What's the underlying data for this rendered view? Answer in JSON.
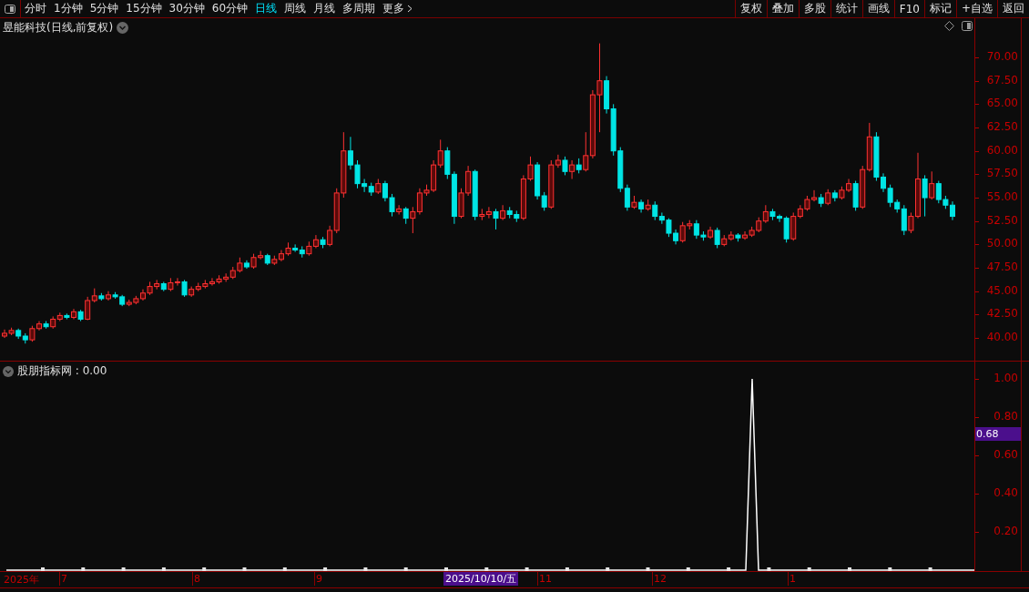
{
  "toolbar": {
    "periods": [
      {
        "label": "分时",
        "selected": false
      },
      {
        "label": "1分钟",
        "selected": false
      },
      {
        "label": "5分钟",
        "selected": false
      },
      {
        "label": "15分钟",
        "selected": false
      },
      {
        "label": "30分钟",
        "selected": false
      },
      {
        "label": "60分钟",
        "selected": false
      },
      {
        "label": "日线",
        "selected": true
      },
      {
        "label": "周线",
        "selected": false
      },
      {
        "label": "月线",
        "selected": false
      },
      {
        "label": "多周期",
        "selected": false
      },
      {
        "label": "更多",
        "selected": false
      }
    ],
    "buttons": [
      "复权",
      "叠加",
      "多股",
      "统计",
      "画线",
      "F10",
      "标记",
      "+自选",
      "返回"
    ]
  },
  "main_chart": {
    "title": "昱能科技(日线,前复权)",
    "chart_data": {
      "type": "candlestick",
      "ylim": [
        37.57,
        74.19
      ],
      "yticks": [
        {
          "value": 70,
          "label": "70.00"
        },
        {
          "value": 67.5,
          "label": "67.50"
        },
        {
          "value": 65,
          "label": "65.00"
        },
        {
          "value": 62.5,
          "label": "62.50"
        },
        {
          "value": 60,
          "label": "60.00"
        },
        {
          "value": 57.5,
          "label": "57.50"
        },
        {
          "value": 55,
          "label": "55.00"
        },
        {
          "value": 52.5,
          "label": "52.50"
        },
        {
          "value": 50,
          "label": "50.00"
        },
        {
          "value": 47.5,
          "label": "47.50"
        },
        {
          "value": 45,
          "label": "45.00"
        },
        {
          "value": 42.5,
          "label": "42.50"
        },
        {
          "value": 40,
          "label": "40.00"
        }
      ],
      "categories": [
        null,
        null,
        null,
        null,
        null,
        null,
        null,
        null,
        null,
        null,
        null,
        null,
        null,
        null,
        null,
        null,
        null,
        null,
        null,
        null,
        null,
        null,
        null,
        null,
        null,
        null,
        null,
        null,
        null,
        null,
        null,
        null,
        null,
        null,
        null,
        null,
        null,
        null,
        null,
        null,
        null,
        null,
        null,
        null,
        null,
        null,
        null,
        null,
        null,
        null,
        null,
        null,
        null,
        null,
        null,
        null,
        null,
        null,
        null,
        null,
        null,
        null,
        null,
        null,
        null,
        null,
        null,
        null,
        null,
        null,
        null,
        null,
        null,
        null,
        null,
        null,
        null,
        null,
        null,
        null,
        null,
        null,
        null,
        null,
        null,
        null,
        null,
        null,
        null,
        null,
        null,
        null,
        null,
        null,
        null,
        null,
        null,
        null,
        null,
        null,
        null,
        null,
        null,
        null,
        null,
        null,
        null,
        null,
        null,
        null,
        null,
        null,
        null,
        null,
        null,
        null,
        null,
        null,
        null,
        null,
        null,
        null,
        null,
        null,
        null,
        null,
        null,
        null,
        null,
        null,
        null,
        null,
        null,
        null,
        null,
        null,
        null,
        null
      ],
      "ohlc": [
        [
          40.2,
          40.9,
          40.0,
          40.5
        ],
        [
          40.5,
          41.1,
          40.3,
          40.8
        ],
        [
          40.8,
          41.0,
          39.9,
          40.2
        ],
        [
          40.2,
          40.5,
          39.4,
          39.8
        ],
        [
          39.8,
          41.3,
          39.6,
          41.0
        ],
        [
          41.0,
          41.8,
          40.8,
          41.5
        ],
        [
          41.5,
          41.8,
          41.0,
          41.2
        ],
        [
          41.2,
          42.3,
          41.0,
          42.0
        ],
        [
          42.0,
          42.7,
          41.8,
          42.4
        ],
        [
          42.4,
          42.6,
          42.0,
          42.2
        ],
        [
          42.2,
          43.1,
          42.0,
          42.8
        ],
        [
          42.8,
          43.0,
          41.8,
          42.0
        ],
        [
          42.0,
          44.4,
          41.9,
          44.0
        ],
        [
          44.0,
          45.3,
          43.8,
          44.5
        ],
        [
          44.5,
          44.8,
          44.0,
          44.2
        ],
        [
          44.2,
          45.0,
          44.0,
          44.6
        ],
        [
          44.6,
          44.9,
          44.2,
          44.4
        ],
        [
          44.4,
          44.6,
          43.4,
          43.6
        ],
        [
          43.6,
          44.1,
          43.4,
          43.8
        ],
        [
          43.8,
          44.5,
          43.6,
          44.2
        ],
        [
          44.2,
          45.2,
          44.0,
          44.8
        ],
        [
          44.8,
          46.0,
          44.6,
          45.5
        ],
        [
          45.5,
          46.2,
          45.2,
          45.8
        ],
        [
          45.8,
          46.0,
          45.0,
          45.2
        ],
        [
          45.2,
          46.4,
          45.0,
          45.9
        ],
        [
          45.9,
          46.4,
          45.6,
          46.0
        ],
        [
          46.0,
          46.2,
          44.4,
          44.6
        ],
        [
          44.6,
          45.5,
          44.4,
          45.2
        ],
        [
          45.2,
          45.9,
          45.0,
          45.5
        ],
        [
          45.5,
          46.2,
          45.3,
          45.8
        ],
        [
          45.8,
          46.4,
          45.6,
          46.0
        ],
        [
          46.0,
          46.7,
          45.8,
          46.3
        ],
        [
          46.3,
          46.9,
          46.0,
          46.5
        ],
        [
          46.5,
          47.6,
          46.3,
          47.2
        ],
        [
          47.2,
          48.6,
          47.0,
          48.0
        ],
        [
          48.0,
          48.3,
          47.4,
          47.6
        ],
        [
          47.6,
          49.0,
          47.4,
          48.6
        ],
        [
          48.6,
          49.3,
          48.4,
          48.8
        ],
        [
          48.8,
          49.0,
          47.8,
          48.0
        ],
        [
          48.0,
          48.8,
          47.8,
          48.4
        ],
        [
          48.4,
          49.4,
          48.2,
          49.0
        ],
        [
          49.0,
          50.2,
          48.8,
          49.6
        ],
        [
          49.6,
          50.0,
          49.2,
          49.4
        ],
        [
          49.4,
          49.8,
          48.6,
          49.0
        ],
        [
          49.0,
          50.3,
          48.8,
          49.8
        ],
        [
          49.8,
          51.0,
          49.6,
          50.5
        ],
        [
          50.5,
          50.8,
          49.6,
          50.0
        ],
        [
          50.0,
          52.0,
          49.8,
          51.5
        ],
        [
          51.5,
          56.0,
          51.2,
          55.5
        ],
        [
          55.5,
          62.0,
          55.0,
          60.0
        ],
        [
          60.0,
          61.5,
          58.0,
          58.5
        ],
        [
          58.5,
          59.0,
          56.0,
          56.5
        ],
        [
          56.5,
          57.0,
          55.6,
          56.2
        ],
        [
          56.2,
          56.6,
          55.2,
          55.6
        ],
        [
          55.6,
          57.0,
          55.4,
          56.5
        ],
        [
          56.5,
          56.8,
          54.6,
          55.0
        ],
        [
          55.0,
          55.4,
          53.0,
          53.5
        ],
        [
          53.5,
          54.2,
          53.2,
          53.8
        ],
        [
          53.8,
          54.0,
          52.2,
          52.8
        ],
        [
          52.8,
          54.0,
          51.2,
          53.5
        ],
        [
          53.5,
          56.0,
          53.2,
          55.5
        ],
        [
          55.5,
          56.4,
          55.2,
          55.8
        ],
        [
          55.8,
          59.0,
          55.6,
          58.5
        ],
        [
          58.5,
          61.2,
          58.2,
          60.0
        ],
        [
          60.0,
          60.4,
          57.0,
          57.5
        ],
        [
          57.5,
          57.8,
          52.2,
          53.0
        ],
        [
          53.0,
          56.0,
          52.8,
          55.5
        ],
        [
          55.5,
          58.4,
          55.2,
          57.8
        ],
        [
          57.8,
          58.0,
          52.6,
          53.0
        ],
        [
          53.0,
          53.8,
          52.6,
          53.2
        ],
        [
          53.2,
          54.0,
          52.8,
          53.5
        ],
        [
          53.5,
          53.8,
          51.6,
          52.8
        ],
        [
          52.8,
          54.2,
          52.6,
          53.6
        ],
        [
          53.6,
          54.0,
          52.8,
          53.2
        ],
        [
          53.2,
          53.6,
          52.4,
          52.8
        ],
        [
          52.8,
          57.4,
          52.6,
          57.0
        ],
        [
          57.0,
          59.4,
          56.8,
          58.5
        ],
        [
          58.5,
          58.8,
          54.8,
          55.2
        ],
        [
          55.2,
          55.6,
          53.6,
          54.0
        ],
        [
          54.0,
          59.0,
          53.8,
          58.5
        ],
        [
          58.5,
          59.6,
          58.2,
          59.0
        ],
        [
          59.0,
          59.4,
          57.4,
          57.8
        ],
        [
          57.8,
          59.0,
          57.0,
          58.5
        ],
        [
          58.5,
          59.2,
          57.6,
          58.0
        ],
        [
          58.0,
          62.0,
          57.8,
          59.5
        ],
        [
          59.5,
          66.5,
          59.2,
          66.0
        ],
        [
          66.0,
          71.5,
          62.0,
          67.5
        ],
        [
          67.5,
          68.0,
          64.0,
          64.5
        ],
        [
          64.5,
          65.0,
          59.5,
          60.0
        ],
        [
          60.0,
          60.4,
          55.6,
          56.0
        ],
        [
          56.0,
          56.4,
          53.6,
          54.0
        ],
        [
          54.0,
          55.2,
          53.8,
          54.5
        ],
        [
          54.5,
          54.8,
          53.4,
          53.8
        ],
        [
          53.8,
          54.8,
          53.6,
          54.2
        ],
        [
          54.2,
          54.6,
          52.6,
          53.0
        ],
        [
          53.0,
          53.4,
          52.2,
          52.6
        ],
        [
          52.6,
          52.8,
          50.8,
          51.2
        ],
        [
          51.2,
          51.6,
          50.0,
          50.4
        ],
        [
          50.4,
          52.4,
          50.2,
          52.0
        ],
        [
          52.0,
          52.6,
          51.6,
          52.2
        ],
        [
          52.2,
          52.6,
          50.6,
          51.0
        ],
        [
          51.0,
          51.4,
          50.4,
          50.8
        ],
        [
          50.8,
          51.9,
          50.6,
          51.5
        ],
        [
          51.5,
          51.8,
          49.6,
          50.0
        ],
        [
          50.0,
          51.0,
          49.8,
          50.6
        ],
        [
          50.6,
          51.4,
          50.4,
          51.0
        ],
        [
          51.0,
          51.2,
          50.3,
          50.7
        ],
        [
          50.7,
          51.4,
          50.5,
          51.0
        ],
        [
          51.0,
          51.9,
          50.8,
          51.5
        ],
        [
          51.5,
          52.9,
          51.3,
          52.5
        ],
        [
          52.5,
          54.2,
          52.3,
          53.5
        ],
        [
          53.5,
          53.8,
          52.6,
          53.0
        ],
        [
          53.0,
          53.2,
          52.4,
          52.8
        ],
        [
          52.8,
          53.0,
          50.2,
          50.6
        ],
        [
          50.6,
          53.4,
          50.4,
          53.0
        ],
        [
          53.0,
          54.2,
          52.8,
          53.8
        ],
        [
          53.8,
          55.2,
          53.6,
          54.8
        ],
        [
          54.8,
          55.8,
          54.6,
          55.0
        ],
        [
          55.0,
          55.4,
          54.0,
          54.4
        ],
        [
          54.4,
          55.9,
          54.2,
          55.5
        ],
        [
          55.5,
          55.8,
          54.6,
          55.0
        ],
        [
          55.0,
          56.2,
          54.8,
          55.8
        ],
        [
          55.8,
          57.0,
          55.6,
          56.5
        ],
        [
          56.5,
          56.8,
          53.6,
          54.0
        ],
        [
          54.0,
          58.4,
          53.8,
          58.0
        ],
        [
          58.0,
          63.0,
          57.8,
          61.5
        ],
        [
          61.5,
          62.0,
          56.8,
          57.2
        ],
        [
          57.2,
          57.6,
          55.6,
          56.0
        ],
        [
          56.0,
          56.4,
          54.0,
          54.5
        ],
        [
          54.5,
          54.8,
          53.4,
          53.8
        ],
        [
          53.8,
          54.2,
          51.0,
          51.5
        ],
        [
          51.5,
          53.4,
          51.2,
          53.0
        ],
        [
          53.0,
          59.8,
          52.8,
          57.0
        ],
        [
          57.0,
          57.4,
          53.0,
          55.0
        ],
        [
          55.0,
          57.8,
          54.8,
          56.5
        ],
        [
          56.5,
          56.8,
          54.4,
          54.8
        ],
        [
          54.8,
          55.2,
          53.8,
          54.2
        ],
        [
          54.2,
          54.6,
          52.6,
          53.0
        ]
      ]
    }
  },
  "indicator": {
    "reading": ": 0.00",
    "cursor_value": "0.68",
    "chart_data": {
      "type": "line",
      "categories": [
        null,
        null,
        null,
        null,
        null,
        null,
        null,
        null,
        null,
        null,
        null,
        null,
        null,
        null,
        null,
        null,
        null,
        null,
        null,
        null,
        null,
        null,
        null,
        null,
        null,
        null,
        null,
        null,
        null,
        null,
        null,
        null,
        null,
        null,
        null,
        null,
        null,
        null,
        null,
        null,
        null,
        null,
        null,
        null,
        null,
        null,
        null,
        null,
        null,
        null,
        null,
        null,
        null,
        null,
        null,
        null,
        null,
        null,
        null,
        null,
        null,
        null,
        null,
        null,
        null,
        null,
        null,
        null,
        null,
        null,
        null,
        null,
        null,
        null,
        null,
        null,
        null,
        null,
        null,
        null,
        null,
        null,
        null,
        null,
        null,
        null,
        null,
        null,
        null,
        null,
        null,
        null,
        null,
        null,
        null,
        null,
        null,
        null,
        null,
        null,
        null,
        null,
        null,
        null,
        null,
        null,
        null,
        null,
        null,
        null,
        null,
        null,
        null,
        null,
        null,
        null,
        null,
        null,
        null,
        null,
        null,
        null,
        null,
        null,
        null,
        null,
        null,
        null,
        null,
        null,
        null,
        null,
        null,
        null,
        null,
        null,
        null,
        null,
        null,
        null,
        null,
        null,
        null,
        null,
        null,
        null,
        null,
        null,
        null,
        null,
        null,
        null,
        null
      ],
      "series": [
        {
          "name": "股朋指标网",
          "color": "#ffffff",
          "values": [
            0,
            0,
            0,
            0,
            0,
            0,
            0,
            0,
            0,
            0,
            0,
            0,
            0,
            0,
            0,
            0,
            0,
            0,
            0,
            0,
            0,
            0,
            0,
            0,
            0,
            0,
            0,
            0,
            0,
            0,
            0,
            0,
            0,
            0,
            0,
            0,
            0,
            0,
            0,
            0,
            0,
            0,
            0,
            0,
            0,
            0,
            0,
            0,
            0,
            0,
            0,
            0,
            0,
            0,
            0,
            0,
            0,
            0,
            0,
            0,
            0,
            0,
            0,
            0,
            0,
            0,
            0,
            0,
            0,
            0,
            0,
            0,
            0,
            0,
            0,
            0,
            0,
            0,
            0,
            0,
            0,
            0,
            0,
            0,
            0,
            0,
            0,
            0,
            0,
            0,
            0,
            0,
            0,
            0,
            0,
            0,
            0,
            0,
            0,
            0,
            0,
            0,
            0,
            0,
            0,
            0,
            0,
            0,
            0,
            0,
            0,
            0,
            0,
            0,
            0,
            0,
            0,
            1,
            0,
            0,
            0,
            0,
            0,
            0,
            0,
            0,
            0,
            0,
            0,
            0,
            0,
            0,
            0,
            0,
            0,
            0,
            0,
            0,
            0,
            0,
            0,
            0,
            0,
            0,
            0,
            0,
            0,
            0,
            0,
            0,
            0,
            0,
            0
          ]
        }
      ],
      "ylim": [
        0,
        1.09
      ],
      "yticks": [
        {
          "value": 1,
          "label": "1.00"
        },
        {
          "value": 0.8,
          "label": "0.80"
        },
        {
          "value": 0.6,
          "label": "0.60"
        },
        {
          "value": 0.4,
          "label": "0.40"
        },
        {
          "value": 0.2,
          "label": "0.20"
        }
      ]
    }
  },
  "date_axis": {
    "year": "2025年",
    "months": [
      "7",
      "8",
      "9",
      "11",
      "12",
      "1"
    ],
    "cursor_date": "2025/10/10/五"
  }
}
